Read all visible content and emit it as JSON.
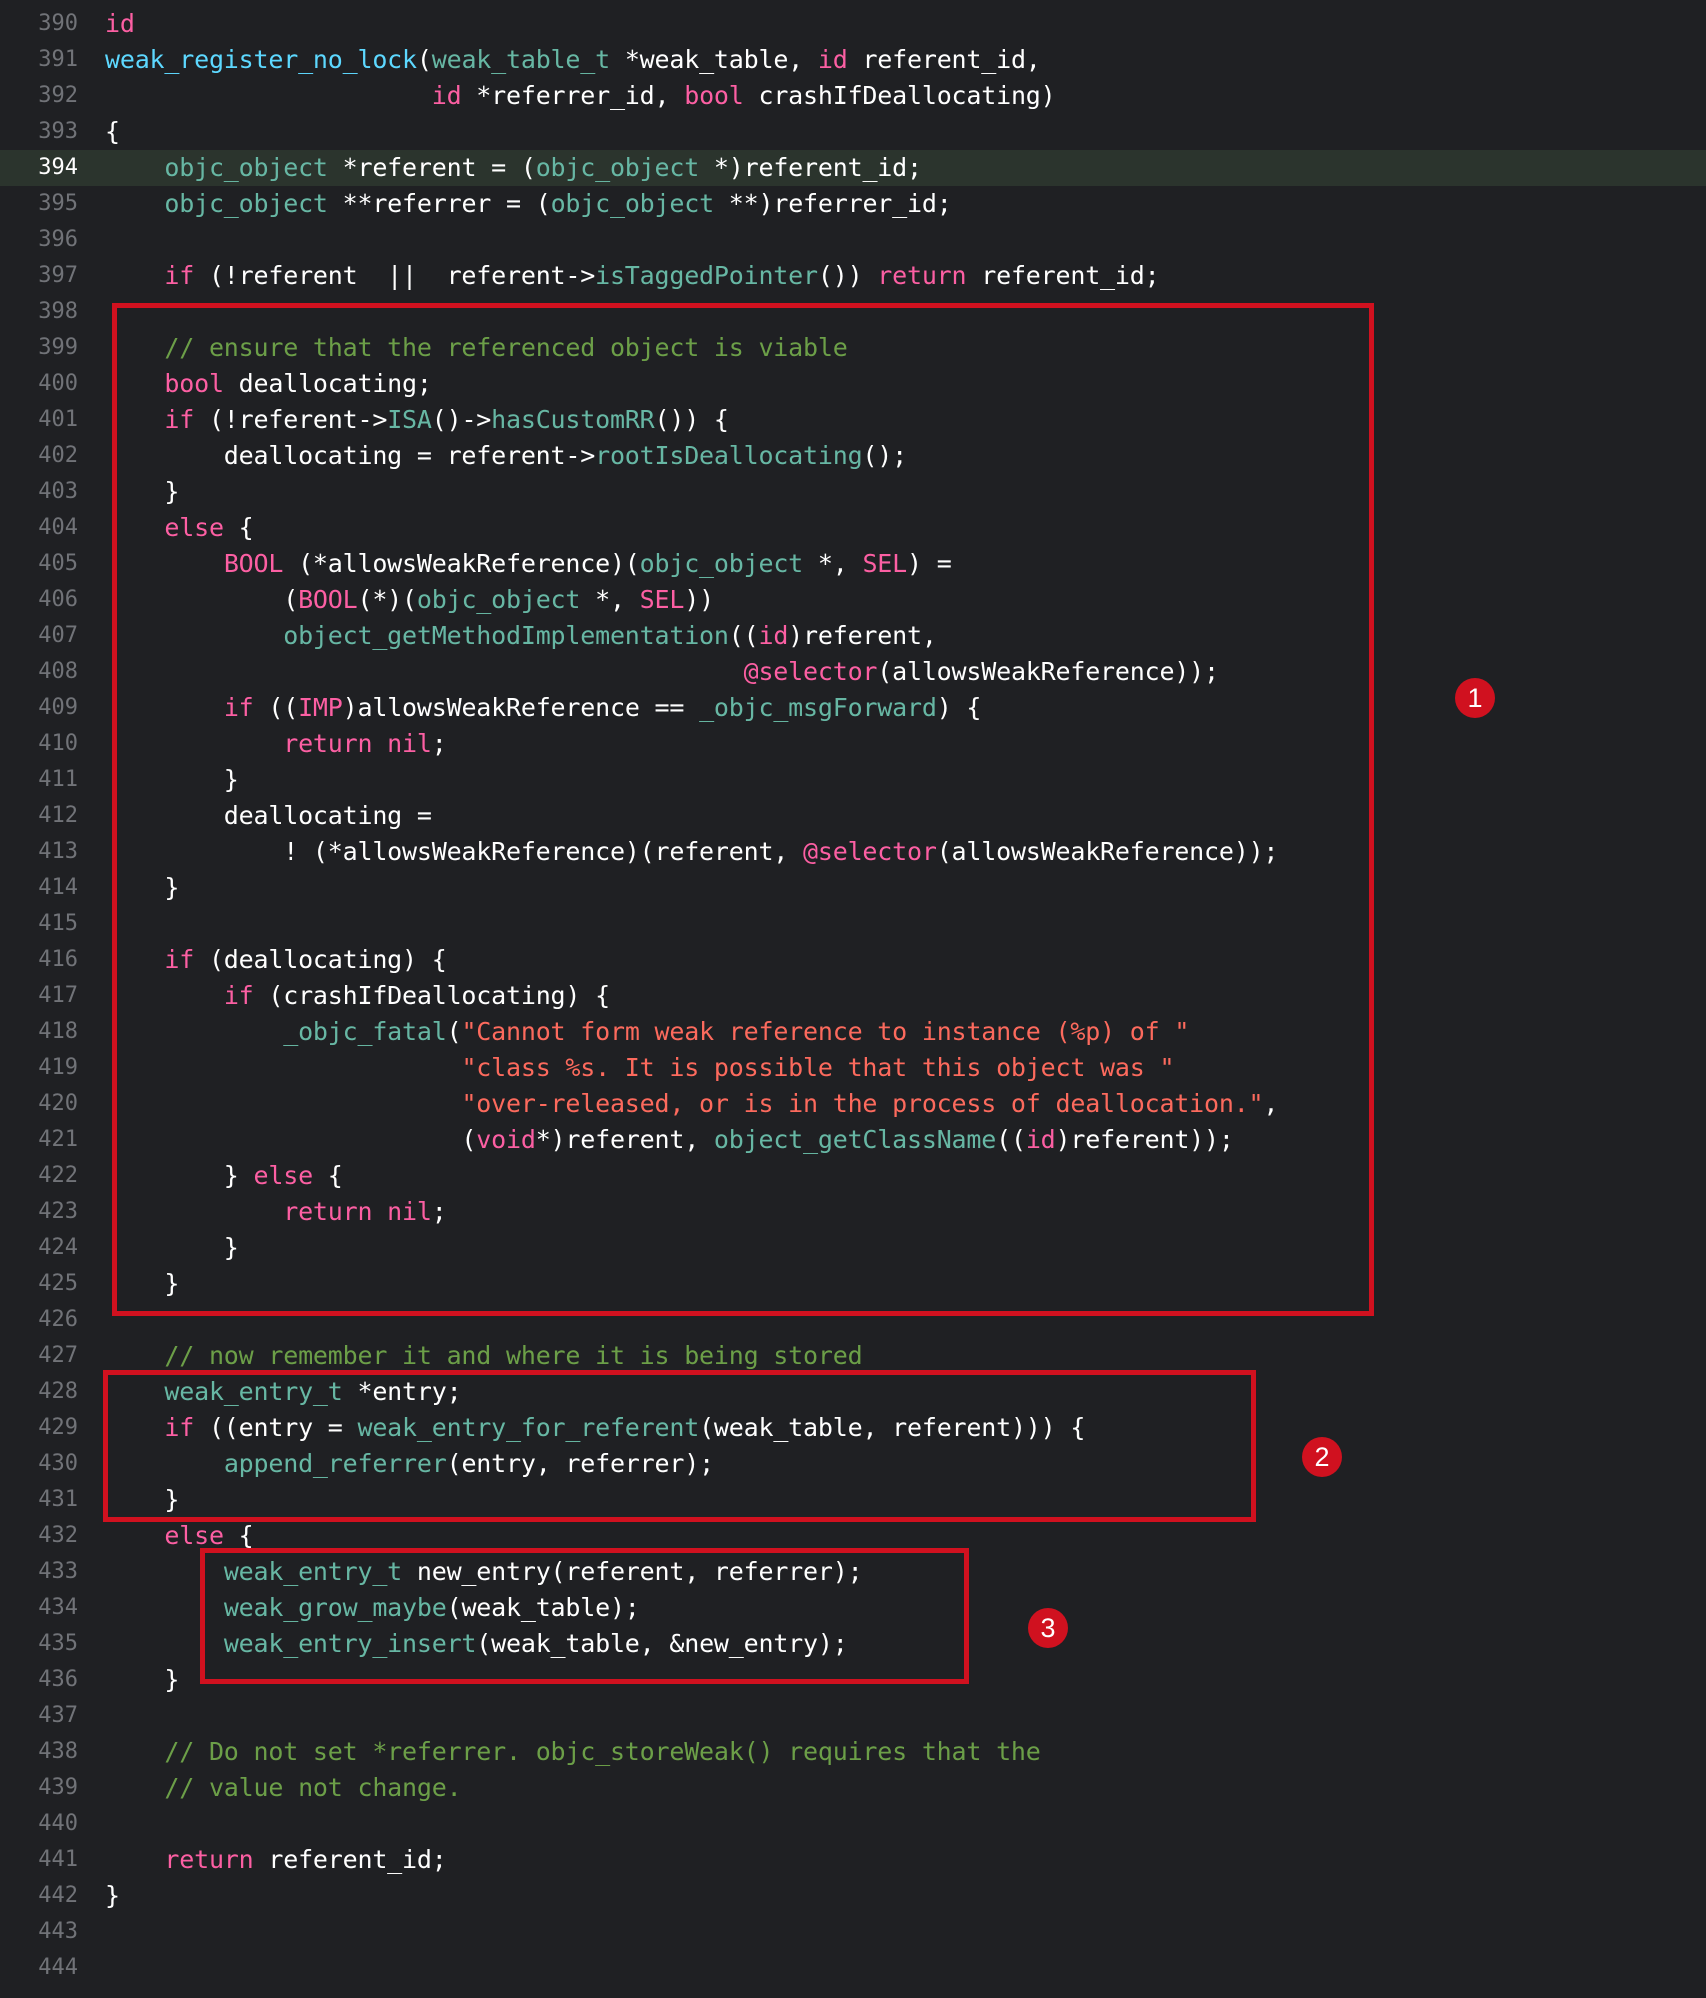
{
  "editor": {
    "current_line": "394",
    "lines": [
      {
        "n": "390",
        "tokens": [
          {
            "t": "id",
            "c": "kw"
          }
        ]
      },
      {
        "n": "391",
        "tokens": [
          {
            "t": "weak_register_no_lock",
            "c": "ty"
          },
          {
            "t": "(",
            "c": "pl"
          },
          {
            "t": "weak_table_t",
            "c": "fn"
          },
          {
            "t": " *weak_table, ",
            "c": "pl"
          },
          {
            "t": "id",
            "c": "kw"
          },
          {
            "t": " referent_id,",
            "c": "pl"
          }
        ]
      },
      {
        "n": "392",
        "tokens": [
          {
            "t": "                      ",
            "c": "pl"
          },
          {
            "t": "id",
            "c": "kw"
          },
          {
            "t": " *referrer_id, ",
            "c": "pl"
          },
          {
            "t": "bool",
            "c": "kw"
          },
          {
            "t": " crashIfDeallocating)",
            "c": "pl"
          }
        ]
      },
      {
        "n": "393",
        "tokens": [
          {
            "t": "{",
            "c": "pl"
          }
        ]
      },
      {
        "n": "394",
        "tokens": [
          {
            "t": "    ",
            "c": "pl"
          },
          {
            "t": "objc_object",
            "c": "fn"
          },
          {
            "t": " *referent = (",
            "c": "pl"
          },
          {
            "t": "objc_object",
            "c": "fn"
          },
          {
            "t": " *)referent_id;",
            "c": "pl"
          }
        ]
      },
      {
        "n": "395",
        "tokens": [
          {
            "t": "    ",
            "c": "pl"
          },
          {
            "t": "objc_object",
            "c": "fn"
          },
          {
            "t": " **referrer = (",
            "c": "pl"
          },
          {
            "t": "objc_object",
            "c": "fn"
          },
          {
            "t": " **)referrer_id;",
            "c": "pl"
          }
        ]
      },
      {
        "n": "396",
        "tokens": []
      },
      {
        "n": "397",
        "tokens": [
          {
            "t": "    ",
            "c": "pl"
          },
          {
            "t": "if",
            "c": "kw"
          },
          {
            "t": " (!referent  ||  referent->",
            "c": "pl"
          },
          {
            "t": "isTaggedPointer",
            "c": "fn"
          },
          {
            "t": "()) ",
            "c": "pl"
          },
          {
            "t": "return",
            "c": "kw"
          },
          {
            "t": " referent_id;",
            "c": "pl"
          }
        ]
      },
      {
        "n": "398",
        "tokens": []
      },
      {
        "n": "399",
        "tokens": [
          {
            "t": "    ",
            "c": "pl"
          },
          {
            "t": "// ensure that the referenced object is viable",
            "c": "cm"
          }
        ]
      },
      {
        "n": "400",
        "tokens": [
          {
            "t": "    ",
            "c": "pl"
          },
          {
            "t": "bool",
            "c": "kw"
          },
          {
            "t": " deallocating;",
            "c": "pl"
          }
        ]
      },
      {
        "n": "401",
        "tokens": [
          {
            "t": "    ",
            "c": "pl"
          },
          {
            "t": "if",
            "c": "kw"
          },
          {
            "t": " (!referent->",
            "c": "pl"
          },
          {
            "t": "ISA",
            "c": "fn"
          },
          {
            "t": "()->",
            "c": "pl"
          },
          {
            "t": "hasCustomRR",
            "c": "fn"
          },
          {
            "t": "()) {",
            "c": "pl"
          }
        ]
      },
      {
        "n": "402",
        "tokens": [
          {
            "t": "        deallocating = referent->",
            "c": "pl"
          },
          {
            "t": "rootIsDeallocating",
            "c": "fn"
          },
          {
            "t": "();",
            "c": "pl"
          }
        ]
      },
      {
        "n": "403",
        "tokens": [
          {
            "t": "    }",
            "c": "pl"
          }
        ]
      },
      {
        "n": "404",
        "tokens": [
          {
            "t": "    ",
            "c": "pl"
          },
          {
            "t": "else",
            "c": "kw"
          },
          {
            "t": " {",
            "c": "pl"
          }
        ]
      },
      {
        "n": "405",
        "tokens": [
          {
            "t": "        ",
            "c": "pl"
          },
          {
            "t": "BOOL",
            "c": "kw"
          },
          {
            "t": " (*allowsWeakReference)(",
            "c": "pl"
          },
          {
            "t": "objc_object",
            "c": "fn"
          },
          {
            "t": " *, ",
            "c": "pl"
          },
          {
            "t": "SEL",
            "c": "kw"
          },
          {
            "t": ") =",
            "c": "pl"
          }
        ]
      },
      {
        "n": "406",
        "tokens": [
          {
            "t": "            (",
            "c": "pl"
          },
          {
            "t": "BOOL",
            "c": "kw"
          },
          {
            "t": "(*)(",
            "c": "pl"
          },
          {
            "t": "objc_object",
            "c": "fn"
          },
          {
            "t": " *, ",
            "c": "pl"
          },
          {
            "t": "SEL",
            "c": "kw"
          },
          {
            "t": "))",
            "c": "pl"
          }
        ]
      },
      {
        "n": "407",
        "tokens": [
          {
            "t": "            ",
            "c": "pl"
          },
          {
            "t": "object_getMethodImplementation",
            "c": "fn"
          },
          {
            "t": "((",
            "c": "pl"
          },
          {
            "t": "id",
            "c": "kw"
          },
          {
            "t": ")referent,",
            "c": "pl"
          }
        ]
      },
      {
        "n": "408",
        "tokens": [
          {
            "t": "                                           ",
            "c": "pl"
          },
          {
            "t": "@selector",
            "c": "kw"
          },
          {
            "t": "(allowsWeakReference));",
            "c": "pl"
          }
        ]
      },
      {
        "n": "409",
        "tokens": [
          {
            "t": "        ",
            "c": "pl"
          },
          {
            "t": "if",
            "c": "kw"
          },
          {
            "t": " ((",
            "c": "pl"
          },
          {
            "t": "IMP",
            "c": "kw"
          },
          {
            "t": ")allowsWeakReference == ",
            "c": "pl"
          },
          {
            "t": "_objc_msgForward",
            "c": "fn"
          },
          {
            "t": ") {",
            "c": "pl"
          }
        ]
      },
      {
        "n": "410",
        "tokens": [
          {
            "t": "            ",
            "c": "pl"
          },
          {
            "t": "return nil",
            "c": "kw"
          },
          {
            "t": ";",
            "c": "pl"
          }
        ]
      },
      {
        "n": "411",
        "tokens": [
          {
            "t": "        }",
            "c": "pl"
          }
        ]
      },
      {
        "n": "412",
        "tokens": [
          {
            "t": "        deallocating =",
            "c": "pl"
          }
        ]
      },
      {
        "n": "413",
        "tokens": [
          {
            "t": "            ! (*allowsWeakReference)(referent, ",
            "c": "pl"
          },
          {
            "t": "@selector",
            "c": "kw"
          },
          {
            "t": "(allowsWeakReference));",
            "c": "pl"
          }
        ]
      },
      {
        "n": "414",
        "tokens": [
          {
            "t": "    }",
            "c": "pl"
          }
        ]
      },
      {
        "n": "415",
        "tokens": []
      },
      {
        "n": "416",
        "tokens": [
          {
            "t": "    ",
            "c": "pl"
          },
          {
            "t": "if",
            "c": "kw"
          },
          {
            "t": " (deallocating) {",
            "c": "pl"
          }
        ]
      },
      {
        "n": "417",
        "tokens": [
          {
            "t": "        ",
            "c": "pl"
          },
          {
            "t": "if",
            "c": "kw"
          },
          {
            "t": " (crashIfDeallocating) {",
            "c": "pl"
          }
        ]
      },
      {
        "n": "418",
        "tokens": [
          {
            "t": "            ",
            "c": "pl"
          },
          {
            "t": "_objc_fatal",
            "c": "fn"
          },
          {
            "t": "(",
            "c": "pl"
          },
          {
            "t": "\"Cannot form weak reference to instance (%p) of \"",
            "c": "str"
          }
        ]
      },
      {
        "n": "419",
        "tokens": [
          {
            "t": "                        ",
            "c": "pl"
          },
          {
            "t": "\"class %s. It is possible that this object was \"",
            "c": "str"
          }
        ]
      },
      {
        "n": "420",
        "tokens": [
          {
            "t": "                        ",
            "c": "pl"
          },
          {
            "t": "\"over-released, or is in the process of deallocation.\"",
            "c": "str"
          },
          {
            "t": ",",
            "c": "pl"
          }
        ]
      },
      {
        "n": "421",
        "tokens": [
          {
            "t": "                        (",
            "c": "pl"
          },
          {
            "t": "void",
            "c": "kw"
          },
          {
            "t": "*)referent, ",
            "c": "pl"
          },
          {
            "t": "object_getClassName",
            "c": "fn"
          },
          {
            "t": "((",
            "c": "pl"
          },
          {
            "t": "id",
            "c": "kw"
          },
          {
            "t": ")referent));",
            "c": "pl"
          }
        ]
      },
      {
        "n": "422",
        "tokens": [
          {
            "t": "        } ",
            "c": "pl"
          },
          {
            "t": "else",
            "c": "kw"
          },
          {
            "t": " {",
            "c": "pl"
          }
        ]
      },
      {
        "n": "423",
        "tokens": [
          {
            "t": "            ",
            "c": "pl"
          },
          {
            "t": "return nil",
            "c": "kw"
          },
          {
            "t": ";",
            "c": "pl"
          }
        ]
      },
      {
        "n": "424",
        "tokens": [
          {
            "t": "        }",
            "c": "pl"
          }
        ]
      },
      {
        "n": "425",
        "tokens": [
          {
            "t": "    }",
            "c": "pl"
          }
        ]
      },
      {
        "n": "426",
        "tokens": []
      },
      {
        "n": "427",
        "tokens": [
          {
            "t": "    ",
            "c": "pl"
          },
          {
            "t": "// now remember it and where it is being stored",
            "c": "cm"
          }
        ]
      },
      {
        "n": "428",
        "tokens": [
          {
            "t": "    ",
            "c": "pl"
          },
          {
            "t": "weak_entry_t",
            "c": "fn"
          },
          {
            "t": " *entry;",
            "c": "pl"
          }
        ]
      },
      {
        "n": "429",
        "tokens": [
          {
            "t": "    ",
            "c": "pl"
          },
          {
            "t": "if",
            "c": "kw"
          },
          {
            "t": " ((entry = ",
            "c": "pl"
          },
          {
            "t": "weak_entry_for_referent",
            "c": "fn"
          },
          {
            "t": "(weak_table, referent))) {",
            "c": "pl"
          }
        ]
      },
      {
        "n": "430",
        "tokens": [
          {
            "t": "        ",
            "c": "pl"
          },
          {
            "t": "append_referrer",
            "c": "fn"
          },
          {
            "t": "(entry, referrer);",
            "c": "pl"
          }
        ]
      },
      {
        "n": "431",
        "tokens": [
          {
            "t": "    }",
            "c": "pl"
          }
        ]
      },
      {
        "n": "432",
        "tokens": [
          {
            "t": "    ",
            "c": "pl"
          },
          {
            "t": "else",
            "c": "kw"
          },
          {
            "t": " {",
            "c": "pl"
          }
        ]
      },
      {
        "n": "433",
        "tokens": [
          {
            "t": "        ",
            "c": "pl"
          },
          {
            "t": "weak_entry_t",
            "c": "fn"
          },
          {
            "t": " new_entry(referent, referrer);",
            "c": "pl"
          }
        ]
      },
      {
        "n": "434",
        "tokens": [
          {
            "t": "        ",
            "c": "pl"
          },
          {
            "t": "weak_grow_maybe",
            "c": "fn"
          },
          {
            "t": "(weak_table);",
            "c": "pl"
          }
        ]
      },
      {
        "n": "435",
        "tokens": [
          {
            "t": "        ",
            "c": "pl"
          },
          {
            "t": "weak_entry_insert",
            "c": "fn"
          },
          {
            "t": "(weak_table, &new_entry);",
            "c": "pl"
          }
        ]
      },
      {
        "n": "436",
        "tokens": [
          {
            "t": "    }",
            "c": "pl"
          }
        ]
      },
      {
        "n": "437",
        "tokens": []
      },
      {
        "n": "438",
        "tokens": [
          {
            "t": "    ",
            "c": "pl"
          },
          {
            "t": "// Do not set *referrer. objc_storeWeak() requires that the",
            "c": "cm"
          }
        ]
      },
      {
        "n": "439",
        "tokens": [
          {
            "t": "    ",
            "c": "pl"
          },
          {
            "t": "// value not change.",
            "c": "cm"
          }
        ]
      },
      {
        "n": "440",
        "tokens": []
      },
      {
        "n": "441",
        "tokens": [
          {
            "t": "    ",
            "c": "pl"
          },
          {
            "t": "return",
            "c": "kw"
          },
          {
            "t": " referent_id;",
            "c": "pl"
          }
        ]
      },
      {
        "n": "442",
        "tokens": [
          {
            "t": "}",
            "c": "pl"
          }
        ]
      },
      {
        "n": "443",
        "tokens": []
      },
      {
        "n": "444",
        "tokens": []
      }
    ]
  },
  "annotations": [
    {
      "label": "1",
      "color": "#d0111f"
    },
    {
      "label": "2",
      "color": "#d0111f"
    },
    {
      "label": "3",
      "color": "#d0111f"
    }
  ],
  "colors": {
    "background": "#1f2023",
    "current_line_highlight": "#2b342d",
    "keyword": "#fc5fa3",
    "function": "#67b7a4",
    "comment": "#6c9f48",
    "string": "#fc6a5d",
    "annotation": "#d0111f"
  }
}
